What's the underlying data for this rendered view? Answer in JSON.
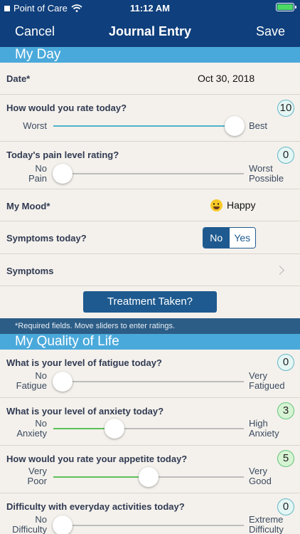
{
  "status_bar": {
    "carrier": "Point of Care",
    "time": "11:12 AM"
  },
  "nav": {
    "cancel_label": "Cancel",
    "title": "Journal Entry",
    "save_label": "Save"
  },
  "sections": {
    "my_day": "My Day",
    "quality_of_life": "My Quality of Life"
  },
  "date_row": {
    "label": "Date*",
    "value": "Oct 30, 2018"
  },
  "rate_today": {
    "label": "How would you rate today?",
    "min_label": "Worst",
    "max_label": "Best",
    "value": "10",
    "level": 10,
    "max": 10
  },
  "pain_level": {
    "label": "Today's pain level rating?",
    "min_label_1": "No",
    "min_label_2": "Pain",
    "max_label_1": "Worst",
    "max_label_2": "Possible",
    "value": "0",
    "level": 0,
    "max": 10
  },
  "mood": {
    "label": "My Mood*",
    "value": "Happy",
    "icon": "happy-face-icon"
  },
  "symptoms_today": {
    "label": "Symptoms today?",
    "no_label": "No",
    "yes_label": "Yes",
    "selected": "No"
  },
  "symptoms": {
    "label": "Symptoms"
  },
  "treatment_button": {
    "label": "Treatment Taken?"
  },
  "info_text": "*Required fields. Move sliders to enter ratings.",
  "fatigue": {
    "label": "What is your level of fatigue today?",
    "min_label_1": "No",
    "min_label_2": "Fatigue",
    "max_label_1": "Very",
    "max_label_2": "Fatigued",
    "value": "0",
    "level": 0,
    "max": 10
  },
  "anxiety": {
    "label": "What is your level of anxiety today?",
    "min_label_1": "No",
    "min_label_2": "Anxiety",
    "max_label_1": "High",
    "max_label_2": "Anxiety",
    "value": "3",
    "level": 3,
    "max": 10
  },
  "appetite": {
    "label": "How would you rate your appetite today?",
    "min_label_1": "Very",
    "min_label_2": "Poor",
    "max_label_1": "Very",
    "max_label_2": "Good",
    "value": "5",
    "level": 5,
    "max": 10
  },
  "activities": {
    "label": "Difficulty with everyday activities today?",
    "min_label_1": "No",
    "min_label_2": "Difficulty",
    "max_label_1": "Extreme",
    "max_label_2": "Difficulty",
    "value": "0",
    "level": 0,
    "max": 10
  },
  "colors": {
    "nav": "#0f3f7c",
    "section": "#4aa9db",
    "button": "#1e5a8f",
    "slider_teal": "#4fb3c8",
    "slider_green": "#5cc15a"
  }
}
